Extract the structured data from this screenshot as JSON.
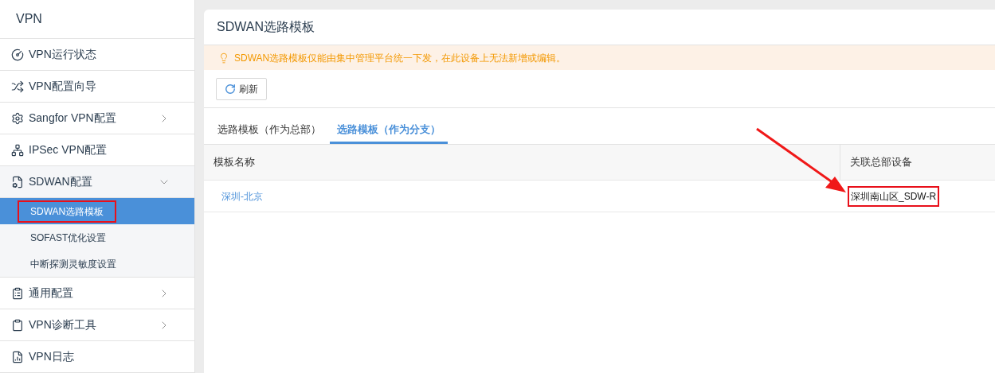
{
  "sidebar": {
    "title": "VPN",
    "items": [
      {
        "label": "VPN运行状态"
      },
      {
        "label": "VPN配置向导"
      },
      {
        "label": "Sangfor VPN配置",
        "expanded": false
      },
      {
        "label": "IPSec VPN配置"
      },
      {
        "label": "SDWAN配置",
        "expanded": true,
        "children": [
          {
            "label": "SDWAN选路模板",
            "selected": true,
            "highlighted": true
          },
          {
            "label": "SOFAST优化设置",
            "selected": false,
            "highlighted": false
          },
          {
            "label": "中断探测灵敏度设置",
            "selected": false,
            "highlighted": false
          }
        ]
      },
      {
        "label": "通用配置",
        "expanded": false
      },
      {
        "label": "VPN诊断工具",
        "expanded": false
      },
      {
        "label": "VPN日志"
      }
    ]
  },
  "page": {
    "title": "SDWAN选路模板",
    "notice": "SDWAN选路模板仅能由集中管理平台统一下发，在此设备上无法新增或编辑。",
    "refresh_button": "刷新",
    "tabs": [
      {
        "label": "选路模板（作为总部）",
        "selected": false
      },
      {
        "label": "选路模板（作为分支）",
        "selected": true
      }
    ],
    "table": {
      "columns": [
        "模板名称",
        "关联总部设备"
      ],
      "rows": [
        {
          "cells": [
            {
              "text": "深圳-北京",
              "highlighted": false
            },
            {
              "text": "深圳南山区_SDW-R",
              "highlighted": true
            }
          ]
        }
      ]
    }
  }
}
